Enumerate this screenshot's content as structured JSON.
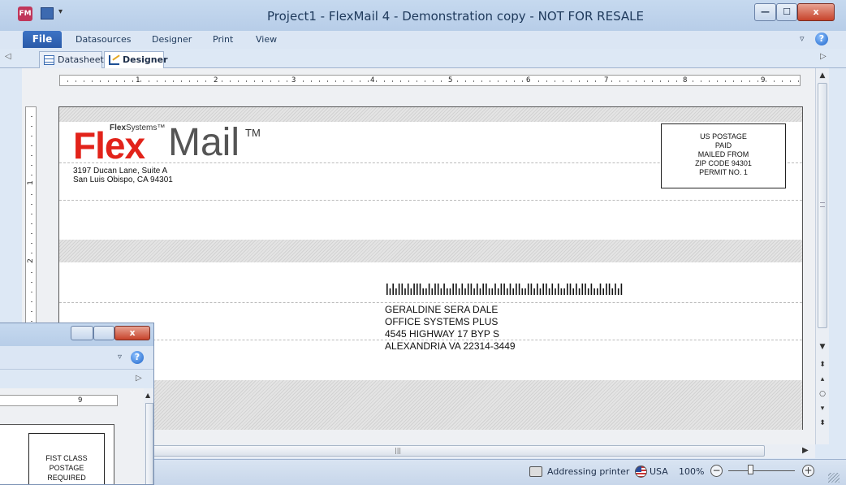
{
  "window": {
    "title": "Project1 - FlexMail 4 - Demonstration copy - NOT FOR RESALE",
    "app_icon": "FM",
    "close_glyph": "x",
    "min_glyph": "—",
    "max_glyph": "☐"
  },
  "menu": {
    "file": "File",
    "items": [
      "Datasources",
      "Designer",
      "Print",
      "View"
    ]
  },
  "tabs": [
    {
      "label": "Datasheet",
      "icon": "datasheet-icon"
    },
    {
      "label": "Designer",
      "icon": "designer-icon"
    }
  ],
  "ruler": {
    "horizontal": [
      "1",
      "2",
      "3",
      "4",
      "5",
      "6",
      "7",
      "8",
      "9"
    ],
    "vertical": [
      "1",
      "2"
    ]
  },
  "envelope": {
    "logo_small_bold": "Flex",
    "logo_small_rest": "Systems™",
    "logo_flex": "Flex",
    "logo_mail": "Mail",
    "logo_tm": "TM",
    "return_address": [
      "3197 Ducan Lane, Suite A",
      "San Luis Obispo, CA 94301"
    ],
    "postage": [
      "US POSTAGE",
      "PAID",
      "MAILED FROM",
      "ZIP CODE 94301",
      "PERMIT NO. 1"
    ],
    "recipient": [
      "GERALDINE SERA DALE",
      "OFFICE SYSTEMS PLUS",
      "4545 HIGHWAY 17 BYP S",
      "ALEXANDRIA VA 22314-3449"
    ]
  },
  "statusbar": {
    "printer": "Addressing printer",
    "country": "USA",
    "zoom": "100%",
    "zoom_fraction": 0.33
  },
  "second_window": {
    "ruler_number": "9",
    "postage": [
      "FIST CLASS",
      "POSTAGE",
      "REQUIRED"
    ]
  }
}
